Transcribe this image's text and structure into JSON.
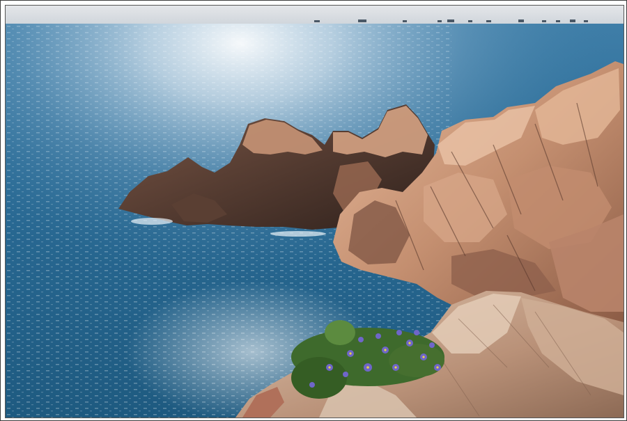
{
  "image": {
    "subject": "rocky-coastline-with-flowers",
    "colors": {
      "sky": "#d9dde2",
      "sea_deep": "#1f5f86",
      "sea_mid": "#3c7fa6",
      "sun_glare": "#f4f7fb",
      "rock_light": "#d9a98a",
      "rock_mid": "#a8735a",
      "rock_dark": "#3e2c26",
      "foreground_rock": "#c9a78e",
      "foliage": "#3f6b2a",
      "flowers": "#6f66c9"
    },
    "ships_on_horizon": 12
  }
}
